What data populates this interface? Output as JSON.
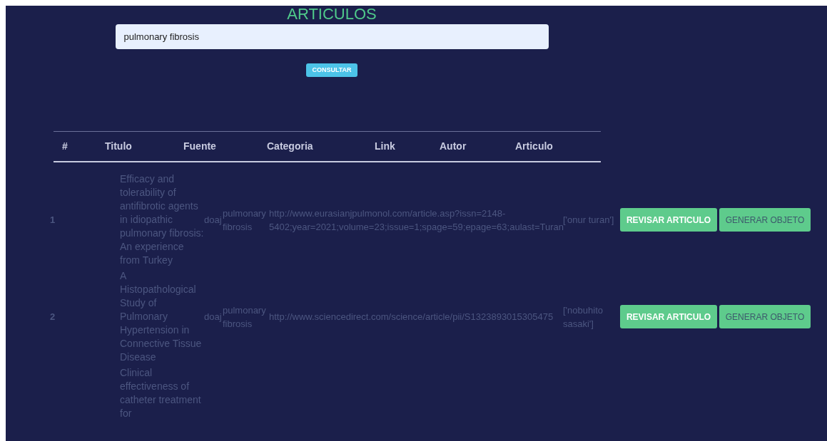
{
  "page": {
    "title": "ARTICULOS"
  },
  "search": {
    "value": "pulmonary fibrosis"
  },
  "consult_button": "CONSULTAR",
  "table": {
    "columns": [
      "#",
      "Titulo",
      "Fuente",
      "Categoria",
      "Link",
      "Autor",
      "Articulo"
    ],
    "rows": [
      {
        "number": "1",
        "title": "Efficacy and tolerability of antifibrotic agents in idiopathic pulmonary fibrosis: An experience from Turkey",
        "source": "doaj",
        "category": "pulmonary fibrosis",
        "link": "http://www.eurasianjpulmonol.com/article.asp?issn=2148-5402;year=2021;volume=23;issue=1;spage=59;epage=63;aulast=Turan",
        "author": "['onur turan']",
        "actions": [
          "REVISAR ARTICULO",
          "GENERAR OBJETO"
        ]
      },
      {
        "number": "2",
        "title": "A Histopathological Study of Pulmonary Hypertension in Connective Tissue Disease",
        "source": "doaj",
        "category": "pulmonary fibrosis",
        "link": "http://www.sciencedirect.com/science/article/pii/S1323893015305475",
        "author": "['nobuhito sasaki']",
        "actions": [
          "REVISAR ARTICULO",
          "GENERAR OBJETO"
        ]
      },
      {
        "title": "Clinical effectiveness of catheter treatment for"
      }
    ]
  }
}
